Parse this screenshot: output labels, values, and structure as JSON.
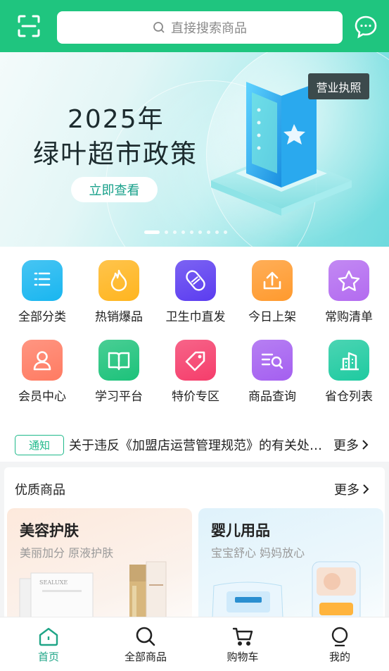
{
  "search": {
    "placeholder": "直接搜索商品"
  },
  "banner": {
    "year": "2025年",
    "title": "绿叶超市政策",
    "cta": "立即查看",
    "license": "营业执照",
    "dots": 9,
    "active_dot": 0
  },
  "categories": [
    {
      "label": "全部分类",
      "icon": "list-icon",
      "color": "#19b6f0"
    },
    {
      "label": "热销爆品",
      "icon": "fire-icon",
      "color": "#ffb51f"
    },
    {
      "label": "卫生巾直发",
      "icon": "pad-icon",
      "color": "#5b3cf0"
    },
    {
      "label": "今日上架",
      "icon": "upload-icon",
      "color": "#ff9a2e"
    },
    {
      "label": "常购清单",
      "icon": "star-icon",
      "color": "#b36bf0"
    },
    {
      "label": "会员中心",
      "icon": "user-icon",
      "color": "#ff7b62"
    },
    {
      "label": "学习平台",
      "icon": "book-icon",
      "color": "#1cc27a"
    },
    {
      "label": "特价专区",
      "icon": "tag-icon",
      "color": "#f53d6b"
    },
    {
      "label": "商品查询",
      "icon": "search-list-icon",
      "color": "#a45ff0"
    },
    {
      "label": "省仓列表",
      "icon": "building-icon",
      "color": "#1ecaa0"
    }
  ],
  "notice": {
    "tag": "通知",
    "text": "关于违反《加盟店运营管理规范》的有关处理通知",
    "more": "更多"
  },
  "featured": {
    "title": "优质商品",
    "more": "更多",
    "cards": [
      {
        "title": "美容护肤",
        "subtitle": "美丽加分 原液护肤",
        "brand": "SEALUXE"
      },
      {
        "title": "婴儿用品",
        "subtitle": "宝宝舒心 妈妈放心"
      }
    ]
  },
  "tabs": [
    {
      "label": "首页",
      "icon": "home-icon",
      "active": true
    },
    {
      "label": "全部商品",
      "icon": "search-icon",
      "active": false
    },
    {
      "label": "购物车",
      "icon": "cart-icon",
      "active": false
    },
    {
      "label": "我的",
      "icon": "profile-icon",
      "active": false
    }
  ],
  "colors": {
    "brand": "#1fc57f",
    "accent": "#1fa587"
  }
}
